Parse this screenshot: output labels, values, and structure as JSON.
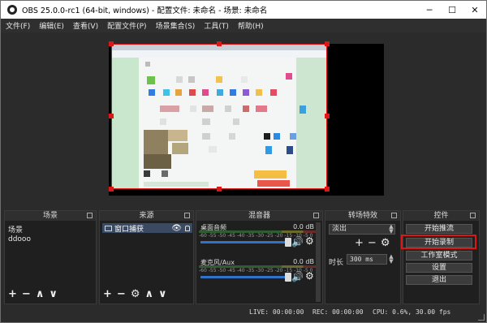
{
  "window": {
    "title": "OBS 25.0.0-rc1 (64-bit, windows) - 配置文件: 未命名 - 场景: 未命名",
    "minimize": "─",
    "maximize": "☐",
    "close": "✕"
  },
  "menu": [
    "文件(F)",
    "编辑(E)",
    "查看(V)",
    "配置文件(P)",
    "场景集合(S)",
    "工具(T)",
    "帮助(H)"
  ],
  "docks": {
    "scenes": {
      "title": "场景",
      "items": [
        "场景",
        "ddooo"
      ],
      "tools": [
        "+",
        "−",
        "∧",
        "∨"
      ]
    },
    "sources": {
      "title": "来源",
      "item": "窗口捕获",
      "tools": [
        "+",
        "−",
        "⚙",
        "∧",
        "∨"
      ]
    },
    "mixer": {
      "title": "混音器",
      "ticks": "-60 -55 -50 -45 -40 -35 -30 -25 -20 -15 -10 -5 0",
      "channels": [
        {
          "name": "桌面音频",
          "db": "0.0 dB"
        },
        {
          "name": "麦克风/Aux",
          "db": "0.0 dB"
        }
      ]
    },
    "transitions": {
      "title": "转场特效",
      "selected": "淡出",
      "tools": [
        "+",
        "−",
        "⚙"
      ],
      "duration_label": "时长",
      "duration_value": "300 ms"
    },
    "controls": {
      "title": "控件",
      "buttons": [
        "开始推流",
        "开始录制",
        "工作室模式",
        "设置",
        "退出"
      ]
    }
  },
  "status": {
    "live": "LIVE: 00:00:00",
    "rec": "REC: 00:00:00",
    "cpu": "CPU: 0.6%, 30.00 fps"
  },
  "colors": {
    "selection": "#e01616",
    "accent": "#2f74c8",
    "selected_row": "#3a4a63"
  }
}
